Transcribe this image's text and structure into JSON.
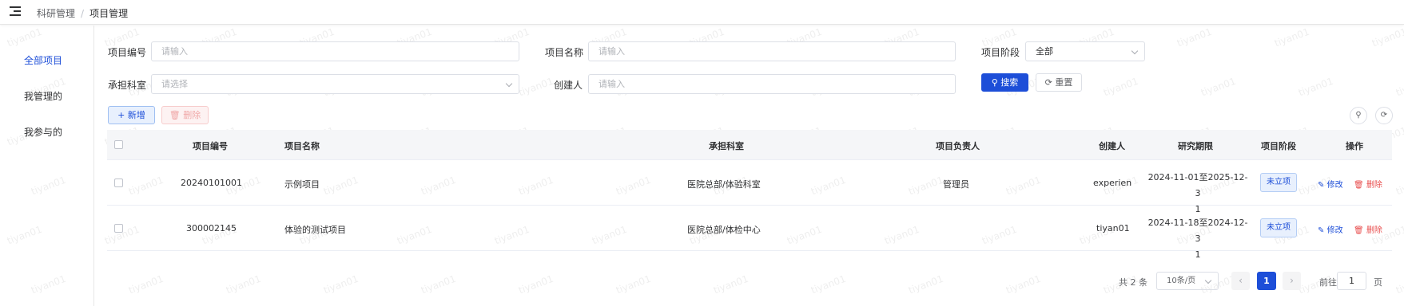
{
  "breadcrumb": [
    "科研管理",
    "项目管理"
  ],
  "breadcrumb_separator": "/",
  "sidebar": {
    "items": [
      {
        "label": "全部项目",
        "active": true
      },
      {
        "label": "我管理的",
        "active": false
      },
      {
        "label": "我参与的",
        "active": false
      }
    ]
  },
  "filters": {
    "project_no": {
      "label": "项目编号",
      "placeholder": "请输入"
    },
    "project_name": {
      "label": "项目名称",
      "placeholder": "请输入"
    },
    "stage": {
      "label": "项目阶段",
      "value": "全部"
    },
    "department": {
      "label": "承担科室",
      "placeholder": "请选择"
    },
    "creator": {
      "label": "创建人",
      "placeholder": "请输入"
    },
    "search_label": "搜索",
    "reset_label": "重置"
  },
  "toolbar": {
    "add_label": "新增",
    "delete_label": "删除"
  },
  "table": {
    "headers": [
      "项目编号",
      "项目名称",
      "承担科室",
      "项目负责人",
      "创建人",
      "研究期限",
      "项目阶段",
      "操作"
    ],
    "rows": [
      {
        "no": "20240101001",
        "name": "示例项目",
        "dept": "医院总部/体验科室",
        "leader": "管理员",
        "creator": "experien",
        "period_1": "2024-11-01至2025-12-3",
        "period_2": "1",
        "stage": "未立项",
        "edit": "修改",
        "delete": "删除"
      },
      {
        "no": "300002145",
        "name": "体验的测试项目",
        "dept": "医院总部/体检中心",
        "leader": "",
        "creator": "tiyan01",
        "period_1": "2024-11-18至2024-12-3",
        "period_2": "1",
        "stage": "未立项",
        "edit": "修改",
        "delete": "删除"
      }
    ]
  },
  "pagination": {
    "total": "共 2 条",
    "page_size": "10条/页",
    "current_page": "1",
    "goto_prefix": "前往",
    "goto_value": "1",
    "goto_suffix": "页"
  },
  "watermark": "tiyan01",
  "colors": {
    "primary": "#1d4ed8",
    "danger": "#e84d4d"
  }
}
